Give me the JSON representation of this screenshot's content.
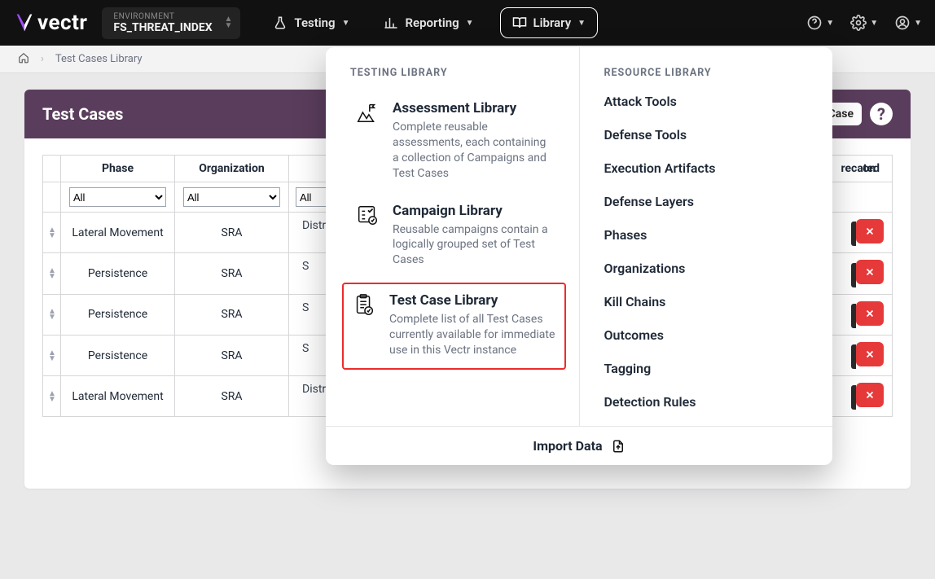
{
  "brand": "vectr",
  "environment": {
    "label": "ENVIRONMENT",
    "value": "FS_THREAT_INDEX"
  },
  "nav": {
    "testing": "Testing",
    "reporting": "Reporting",
    "library": "Library"
  },
  "breadcrumb": {
    "page": "Test Cases Library"
  },
  "panel": {
    "title": "Test Cases",
    "button_fragment": "Case",
    "deprecated_label": "recated",
    "action_col_fragment": "on"
  },
  "columns": {
    "phase": "Phase",
    "org": "Organization"
  },
  "filters": {
    "all": "All"
  },
  "rows": [
    {
      "phase": "Lateral Movement",
      "org": "SRA",
      "rest_prefix": "Distri"
    },
    {
      "phase": "Persistence",
      "org": "SRA",
      "rest_prefix": "S"
    },
    {
      "phase": "Persistence",
      "org": "SRA",
      "rest_prefix": "S"
    },
    {
      "phase": "Persistence",
      "org": "SRA",
      "rest_prefix": "S"
    },
    {
      "phase": "Lateral Movement",
      "org": "SRA",
      "rest_prefix": "Distri"
    }
  ],
  "mega": {
    "left_header": "TESTING LIBRARY",
    "right_header": "RESOURCE LIBRARY",
    "items": [
      {
        "title": "Assessment Library",
        "desc": "Complete reusable assessments, each containing a collection of Campaigns and Test Cases"
      },
      {
        "title": "Campaign Library",
        "desc": "Reusable campaigns contain a logically grouped set of Test Cases"
      },
      {
        "title": "Test Case Library",
        "desc": "Complete list of all Test Cases currently available for immediate use in this Vectr instance"
      }
    ],
    "resources": [
      "Attack Tools",
      "Defense Tools",
      "Execution Artifacts",
      "Defense Layers",
      "Phases",
      "Organizations",
      "Kill Chains",
      "Outcomes",
      "Tagging",
      "Detection Rules"
    ],
    "import": "Import Data"
  }
}
